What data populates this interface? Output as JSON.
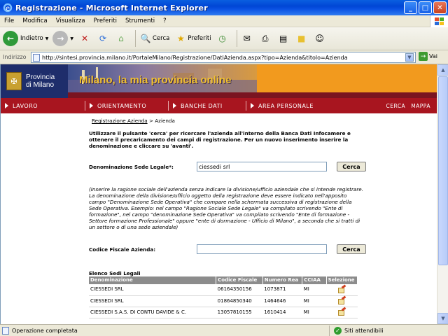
{
  "window": {
    "title": "Registrazione - Microsoft Internet Explorer"
  },
  "menu": [
    "File",
    "Modifica",
    "Visualizza",
    "Preferiti",
    "Strumenti",
    "?"
  ],
  "toolbar": {
    "back": "Indietro",
    "search": "Cerca",
    "favorites": "Preferiti"
  },
  "address": {
    "label": "Indirizzo",
    "url": "http://sintesi.provincia.milano.it/PortaleMilano/Registrazione/DatiAzienda.aspx?tipo=Azienda&titolo=Azienda",
    "go": "Vai"
  },
  "site": {
    "logo_line1": "Provincia",
    "logo_line2": "di Milano",
    "banner_text": "Milano, la mia provincia online",
    "nav": [
      "LAVORO",
      "ORIENTAMENTO",
      "BANCHE DATI",
      "AREA PERSONALE"
    ],
    "nav_right": [
      "CERCA",
      "MAPPA"
    ]
  },
  "breadcrumb": {
    "link": "Registrazione Azienda",
    "sep": ">",
    "current": "Azienda"
  },
  "intro": "Utilizzare il pulsante 'cerca' per ricercare l'azienda all'interno della Banca Dati Infocamere e ottenere il precaricamento dei campi di registrazione. Per un nuovo inserimento inserire la denominazione e cliccare su 'avanti'.",
  "form": {
    "denominazione_label": "Denominazione Sede Legale*:",
    "denominazione_value": "ciessedi srl",
    "cerca": "Cerca",
    "note": "(Inserire la ragione sociale dell'azienda senza indicare la divisione/ufficio aziendale che si intende registrare. La denominazione della divisione/ufficio oggetto della registrazione deve essere indicato nell'apposito campo \"Denominazione Sede Operativa\" che compare nella schermata successiva di registrazione della Sede Operativa. Esempio: nel campo \"Ragione Sociale Sede Legale\" va compilato scrivendo \"Ente di formazione\", nel campo \"denominazione Sede Operativa\" va compilato scrivendo \"Ente di formazione - Settore formazione Professionale\" oppure \"ente di dormazione - Ufficio di Milano\", a seconda che si tratti di un settore o di una sede aziendale)",
    "cf_label": "Codice Fiscale Azienda:",
    "cf_value": ""
  },
  "table": {
    "title": "Elenco Sedi Legali",
    "headers": [
      "Denominazione",
      "Codice Fiscale",
      "Numero Rea",
      "CCIAA",
      "Selezione"
    ],
    "rows": [
      [
        "CIESSEDI SRL",
        "06164350156",
        "1073871",
        "MI"
      ],
      [
        "CIESSEDI SRL",
        "01864850340",
        "1464646",
        "MI"
      ],
      [
        "CIESSEDI S.A.S. DI CONTU DAVIDE & C.",
        "13057810155",
        "1610414",
        "MI"
      ]
    ]
  },
  "status": {
    "left": "Operazione completata",
    "right": "Siti attendibili"
  }
}
